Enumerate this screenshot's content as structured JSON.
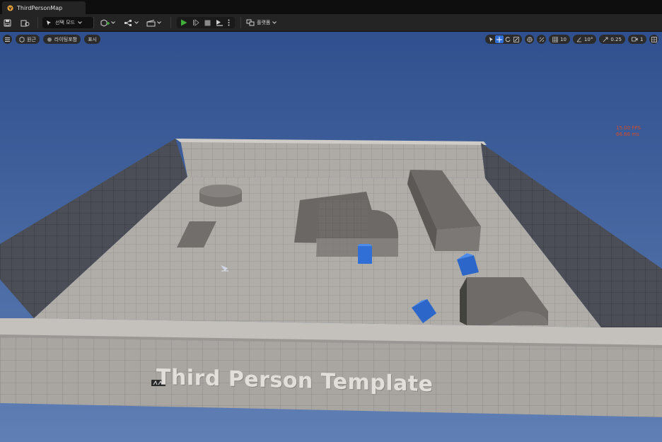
{
  "tab": {
    "title": "ThirdPersonMap"
  },
  "toolbar": {
    "mode_label": "선택 모드",
    "platforms_label": "플랫폼"
  },
  "viewport_bar": {
    "perspective_label": "원근",
    "lighting_label": "라이팅포함",
    "show_label": "표시",
    "grid_snap_value": "10",
    "rotation_snap_value": "10°",
    "scale_snap_value": "0.25",
    "camera_speed_value": "1"
  },
  "stats": {
    "fps": "15.00 FPS",
    "ms": "66.66 ms"
  },
  "scene": {
    "floor_text": "Third Person Template"
  },
  "colors": {
    "accent_blue": "#2f6fd6",
    "play_green": "#3fb13a",
    "sky_top": "#2f4f8e",
    "sky_bottom": "#5f7fb5",
    "stats_red": "#d24a2a"
  },
  "icons": [
    "unreal-logo-icon",
    "save-icon",
    "content-browser-icon",
    "cursor-icon",
    "add-actor-icon",
    "blueprint-icon",
    "cinematics-icon",
    "play-icon",
    "step-icon",
    "stop-icon",
    "eject-icon",
    "more-icon",
    "platforms-icon",
    "hamburger-icon",
    "perspective-icon",
    "lighting-icon",
    "select-tool-icon",
    "move-tool-icon",
    "rotate-tool-icon",
    "scale-tool-icon",
    "world-space-icon",
    "surface-snap-icon",
    "grid-icon",
    "angle-icon",
    "scale-snap-icon",
    "camera-icon",
    "maximize-icon"
  ]
}
